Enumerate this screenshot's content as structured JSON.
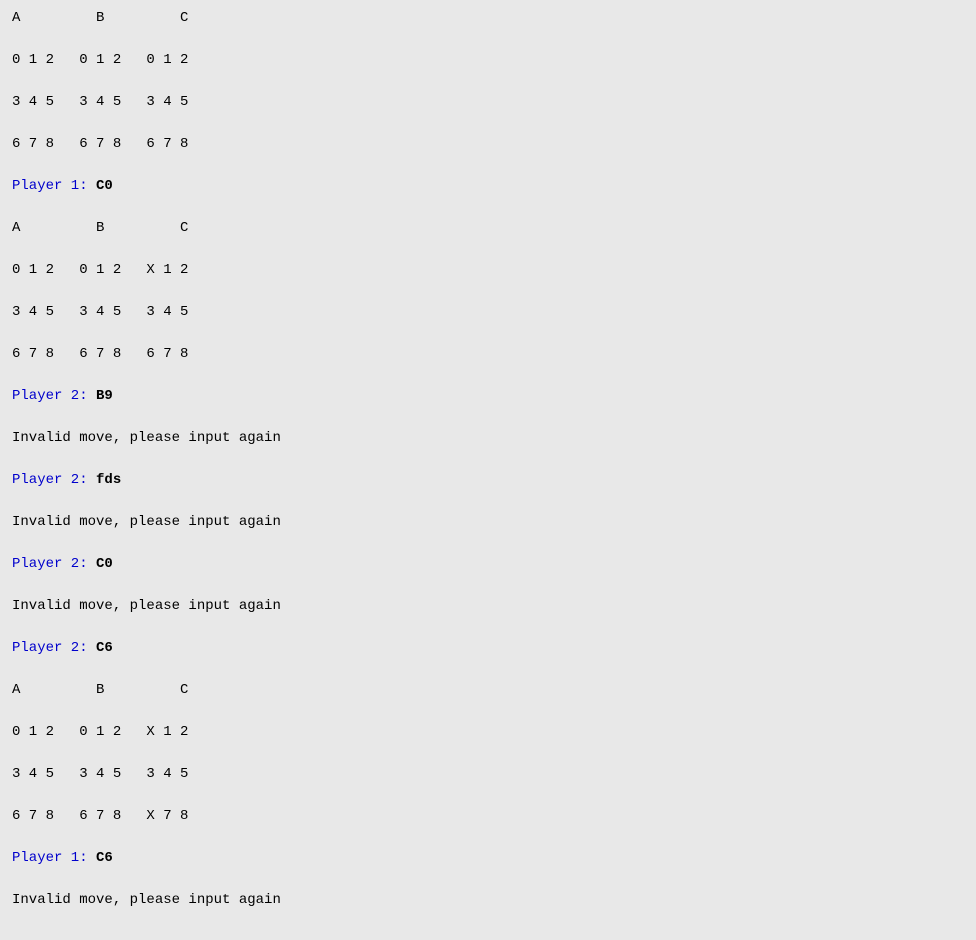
{
  "content": {
    "blocks": [
      {
        "type": "grid",
        "header": "A         B         C",
        "rows": [
          "0 1 2   0 1 2   0 1 2",
          "3 4 5   3 4 5   3 4 5",
          "6 7 8   6 7 8   6 7 8"
        ]
      },
      {
        "type": "player",
        "text": "Player 1: ",
        "input": "C0"
      },
      {
        "type": "grid",
        "header": "A         B         C",
        "rows": [
          "0 1 2   0 1 2   X 1 2",
          "3 4 5   3 4 5   3 4 5",
          "6 7 8   6 7 8   6 7 8"
        ]
      },
      {
        "type": "player",
        "text": "Player 2: ",
        "input": "B9"
      },
      {
        "type": "invalid",
        "text": "Invalid move, please input again"
      },
      {
        "type": "player",
        "text": "Player 2: ",
        "input": "fds"
      },
      {
        "type": "invalid",
        "text": "Invalid move, please input again"
      },
      {
        "type": "player",
        "text": "Player 2: ",
        "input": "C0"
      },
      {
        "type": "invalid",
        "text": "Invalid move, please input again"
      },
      {
        "type": "player",
        "text": "Player 2: ",
        "input": "C6"
      },
      {
        "type": "grid",
        "header": "A         B         C",
        "rows": [
          "0 1 2   0 1 2   X 1 2",
          "3 4 5   3 4 5   3 4 5",
          "6 7 8   6 7 8   X 7 8"
        ]
      },
      {
        "type": "player",
        "text": "Player 1: ",
        "input": "C6"
      },
      {
        "type": "invalid",
        "text": "Invalid move, please input again"
      }
    ]
  }
}
